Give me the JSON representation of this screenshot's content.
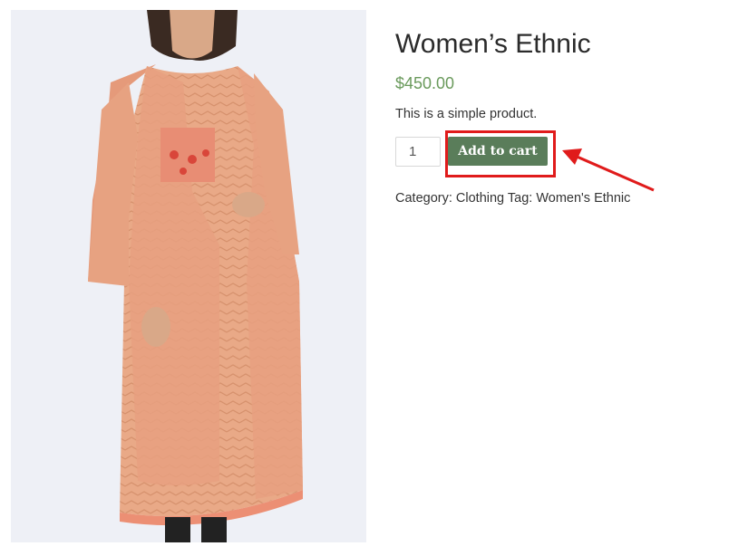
{
  "product": {
    "image_alt": "Woman wearing orange ethnic kurta with jacket",
    "title": "Women’s Ethnic",
    "price": "$450.00",
    "description": "This is a simple product.",
    "quantity": "1",
    "add_to_cart_label": "Add to cart",
    "category_prefix": "Category:",
    "category": "Clothing",
    "tag_prefix": "Tag:",
    "tag": "Women's Ethnic"
  },
  "colors": {
    "price": "#6a9a5c",
    "button": "#5a7d5a",
    "annotation": "#e01b1b"
  }
}
